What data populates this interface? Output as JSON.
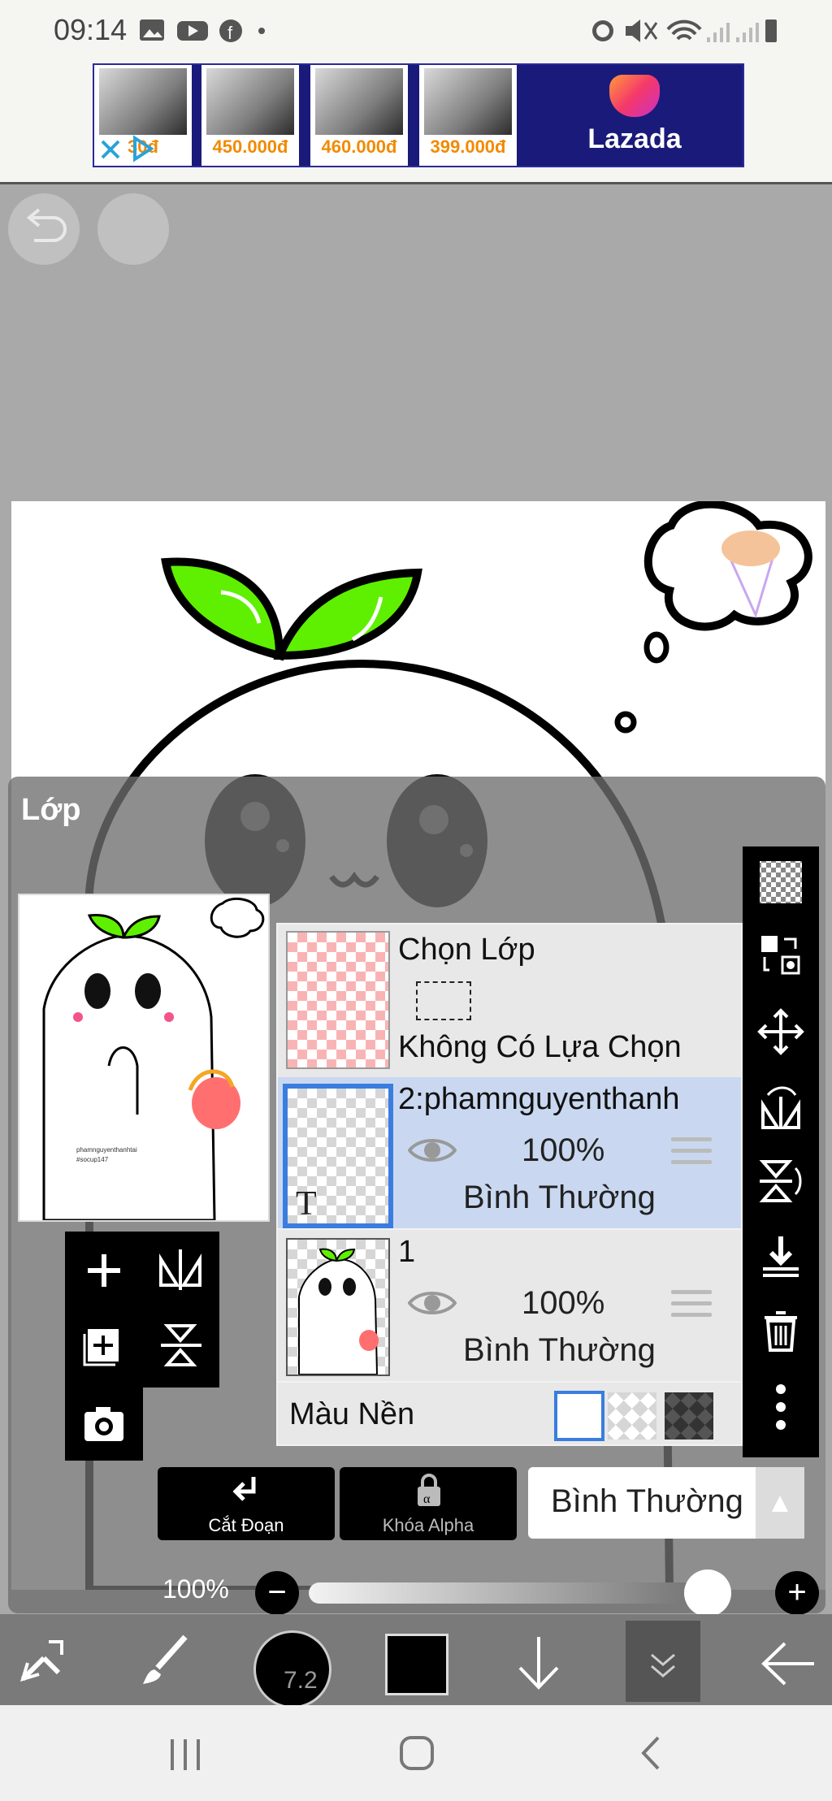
{
  "status_bar": {
    "time": "09:14"
  },
  "ad": {
    "items": [
      {
        "price": "30đ"
      },
      {
        "price": "450.000đ"
      },
      {
        "price": "460.000đ"
      },
      {
        "price": "399.000đ"
      }
    ],
    "brand": "Lazada"
  },
  "layers_panel": {
    "title": "Lớp",
    "selection_layer": {
      "name": "Chọn Lớp",
      "status": "Không Có Lựa Chọn"
    },
    "layers": [
      {
        "name": "2:phamnguyenthanh",
        "opacity": "100%",
        "blend": "Bình Thường",
        "selected": true,
        "type_badge": "T"
      },
      {
        "name": "1",
        "opacity": "100%",
        "blend": "Bình Thường",
        "selected": false
      }
    ],
    "background_label": "Màu Nền"
  },
  "controls": {
    "clip_label": "Cắt Đoạn",
    "alpha_lock_label": "Khóa Alpha",
    "blend_mode": "Bình Thường",
    "opacity_label": "100%",
    "opacity_value": 1.0
  },
  "toolbar": {
    "brush_size": "7.2",
    "color": "#000000"
  },
  "colors": {
    "accent": "#3a7ddf",
    "selected_row": "#c9d8f0",
    "leaf_green": "#5ef000"
  }
}
